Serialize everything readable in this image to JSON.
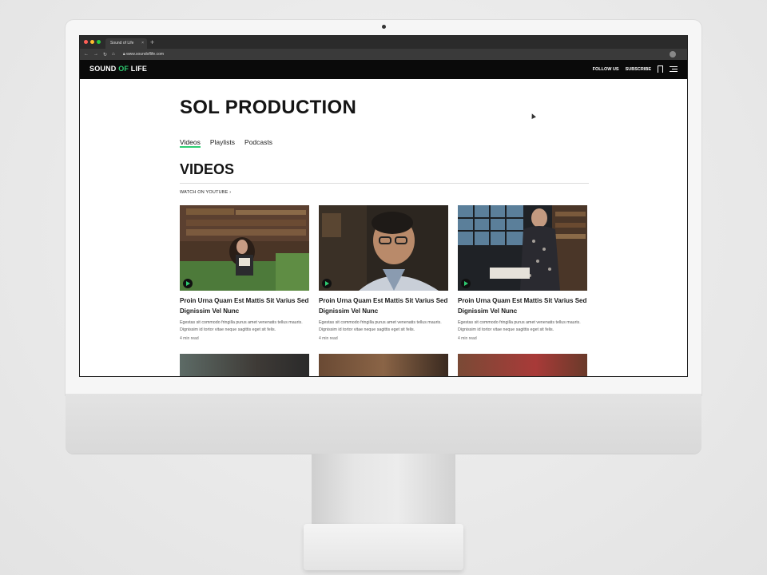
{
  "browser": {
    "tab_title": "Sound of Life",
    "tab_close": "×",
    "new_tab": "+",
    "url": "www.soundoflife.com",
    "nav_icons": [
      "back-icon",
      "forward-icon",
      "reload-icon",
      "home-icon"
    ]
  },
  "site": {
    "logo_prefix": "SOUND ",
    "logo_mark": "OF",
    "logo_suffix": " LIFE",
    "follow": "FOLLOW US",
    "subscribe": "SUBSCRIBE"
  },
  "page": {
    "title": "SOL PRODUCTION",
    "tabs": [
      "Videos",
      "Playlists",
      "Podcasts"
    ],
    "active_tab": "Videos",
    "section_title": "VIDEOS",
    "watch_link": "WATCH ON YOUTUBE",
    "cards": [
      {
        "title": "Proin Urna Quam Est Mattis Sit Varius Sed Dignissim Vel Nunc",
        "desc": "Egestas sit commodo fringilla purus amet venenatis tellus mauris. Dignissim id tortor vitae neque sagittis eget sit felis.",
        "read": "4 min read"
      },
      {
        "title": "Proin Urna Quam Est Mattis Sit Varius Sed Dignissim Vel Nunc",
        "desc": "Egestas sit commodo fringilla purus amet venenatis tellus mauris. Dignissim id tortor vitae neque sagittis eget sit felis.",
        "read": "4 min read"
      },
      {
        "title": "Proin Urna Quam Est Mattis Sit Varius Sed Dignissim Vel Nunc",
        "desc": "Egestas sit commodo fringilla purus amet venenatis tellus mauris. Dignissim id tortor vitae neque sagittis eget sit felis.",
        "read": "4 min read"
      }
    ]
  },
  "colors": {
    "accent": "#2ecc71",
    "header_bg": "#0a0a0a",
    "text": "#141414"
  }
}
